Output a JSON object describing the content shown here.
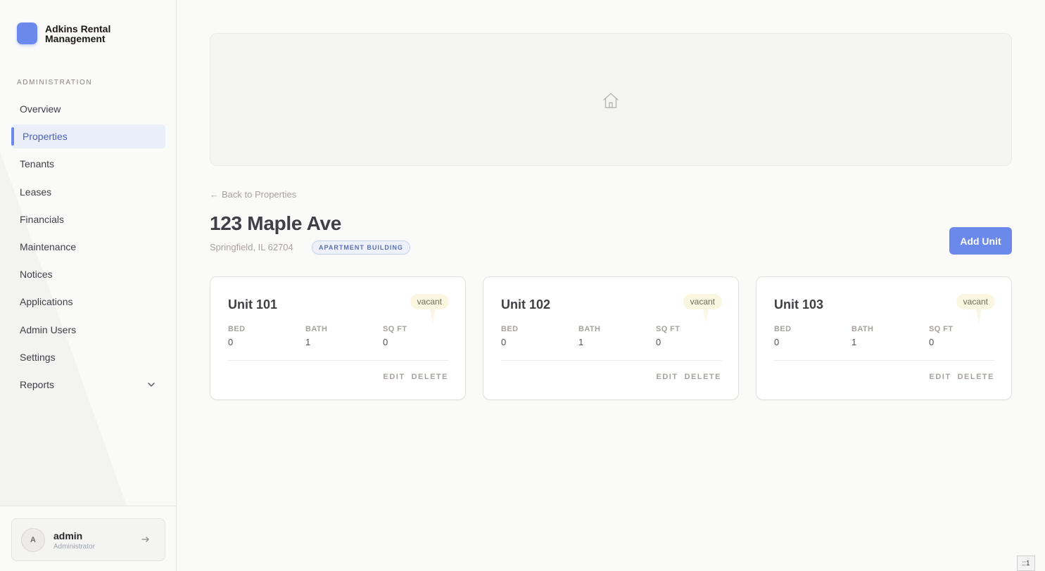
{
  "brand": {
    "name": "Adkins Rental Management",
    "color": "#6b89ea"
  },
  "sidebar": {
    "section_label": "ADMINISTRATION",
    "items": [
      {
        "label": "Overview",
        "name": "sidebar-item-overview",
        "active": false
      },
      {
        "label": "Properties",
        "name": "sidebar-item-properties",
        "active": true
      },
      {
        "label": "Tenants",
        "name": "sidebar-item-tenants",
        "active": false
      },
      {
        "label": "Leases",
        "name": "sidebar-item-leases",
        "active": false
      },
      {
        "label": "Financials",
        "name": "sidebar-item-financials",
        "active": false
      },
      {
        "label": "Maintenance",
        "name": "sidebar-item-maintenance",
        "active": false
      },
      {
        "label": "Notices",
        "name": "sidebar-item-notices",
        "active": false
      },
      {
        "label": "Applications",
        "name": "sidebar-item-applications",
        "active": false
      },
      {
        "label": "Admin Users",
        "name": "sidebar-item-admin-users",
        "active": false
      },
      {
        "label": "Settings",
        "name": "sidebar-item-settings",
        "active": false
      },
      {
        "label": "Reports",
        "name": "sidebar-item-reports",
        "active": false,
        "expandable": true
      }
    ],
    "user": {
      "avatar_initial": "A",
      "name": "admin",
      "role": "Administrator"
    }
  },
  "hero": {
    "icon": "home-icon"
  },
  "property": {
    "back_label": "Back to Properties",
    "title": "123 Maple Ave",
    "address": "Springfield, IL 62704",
    "type": "APARTMENT BUILDING",
    "add_unit_label": "Add Unit"
  },
  "units": [
    {
      "name": "Unit 101",
      "status": "vacant",
      "bed_label": "BED",
      "bed": "0",
      "bath_label": "BATH",
      "bath": "1",
      "sqft_label": "SQ FT",
      "sqft": "0",
      "edit_label": "EDIT",
      "delete_label": "DELETE"
    },
    {
      "name": "Unit 102",
      "status": "vacant",
      "bed_label": "BED",
      "bed": "0",
      "bath_label": "BATH",
      "bath": "1",
      "sqft_label": "SQ FT",
      "sqft": "0",
      "edit_label": "EDIT",
      "delete_label": "DELETE"
    },
    {
      "name": "Unit 103",
      "status": "vacant",
      "bed_label": "BED",
      "bed": "0",
      "bath_label": "BATH",
      "bath": "1",
      "sqft_label": "SQ FT",
      "sqft": "0",
      "edit_label": "EDIT",
      "delete_label": "DELETE"
    }
  ],
  "corner_tag": "::1"
}
